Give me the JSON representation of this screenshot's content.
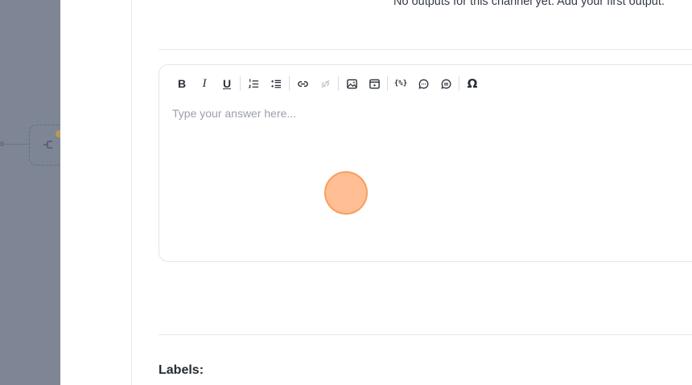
{
  "outputs": {
    "empty_message": "No outputs for this channel yet. Add your first output."
  },
  "editor": {
    "placeholder": "Type your answer here...",
    "toolbar": {
      "bold": "B",
      "italic": "I",
      "underline": "U",
      "variable": "{%}",
      "special_char": "Ω"
    }
  },
  "labels": {
    "title": "Labels:"
  },
  "colors": {
    "canvas": "#7e8594",
    "accent_cursor": "#ffbe94",
    "border": "#e3e5e9"
  }
}
